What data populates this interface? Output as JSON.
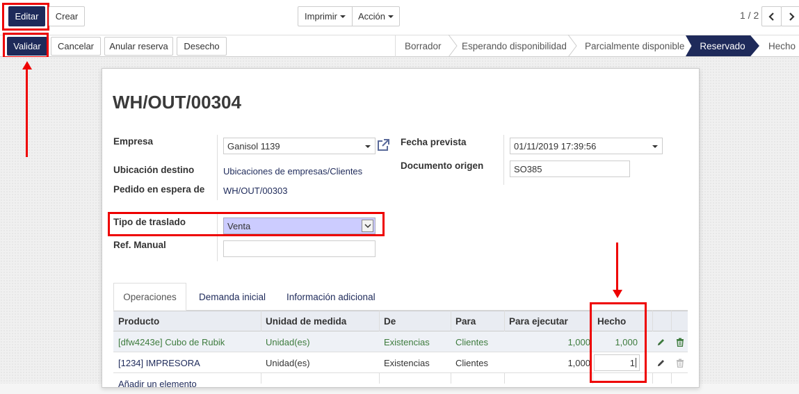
{
  "toolbar": {
    "edit_label": "Editar",
    "create_label": "Crear",
    "print_label": "Imprimir",
    "action_label": "Acción",
    "pager": "1 / 2"
  },
  "actions": {
    "validate_label": "Validar",
    "cancel_label": "Cancelar",
    "unreserve_label": "Anular reserva",
    "scrap_label": "Desecho"
  },
  "statusbar": {
    "stages": [
      "Borrador",
      "Esperando disponibilidad",
      "Parcialmente disponible",
      "Reservado",
      "Hecho"
    ],
    "active": "Reservado"
  },
  "record": {
    "name": "WH/OUT/00304",
    "company_label": "Empresa",
    "company_value": "Ganisol 1139",
    "dest_label": "Ubicación destino",
    "dest_value": "Ubicaciones de empresas/Clientes",
    "backorder_label": "Pedido en espera de",
    "backorder_value": "WH/OUT/00303",
    "transfer_type_label": "Tipo de traslado",
    "transfer_type_value": "Venta",
    "manual_ref_label": "Ref. Manual",
    "manual_ref_value": "",
    "scheduled_label": "Fecha prevista",
    "scheduled_value": "01/11/2019 17:39:56",
    "origin_label": "Documento origen",
    "origin_value": "SO385"
  },
  "tabs": [
    "Operaciones",
    "Demanda inicial",
    "Información adicional"
  ],
  "table": {
    "columns": [
      "Producto",
      "Unidad de medida",
      "De",
      "Para",
      "Para ejecutar",
      "Hecho"
    ],
    "rows": [
      {
        "product": "[dfw4243e] Cubo de Rubik",
        "uom": "Unidad(es)",
        "from": "Existencias",
        "to": "Clientes",
        "todo": "1,000",
        "done": "1,000"
      },
      {
        "product": "[1234] IMPRESORA",
        "uom": "Unidad(es)",
        "from": "Existencias",
        "to": "Clientes",
        "todo": "1,000",
        "done": "1"
      }
    ],
    "add_line": "Añadir un elemento"
  },
  "colors": {
    "primary": "#1e2a5a",
    "highlight": "#e00000",
    "select_bg": "#ccccff",
    "done_green": "#3d7b3d"
  }
}
